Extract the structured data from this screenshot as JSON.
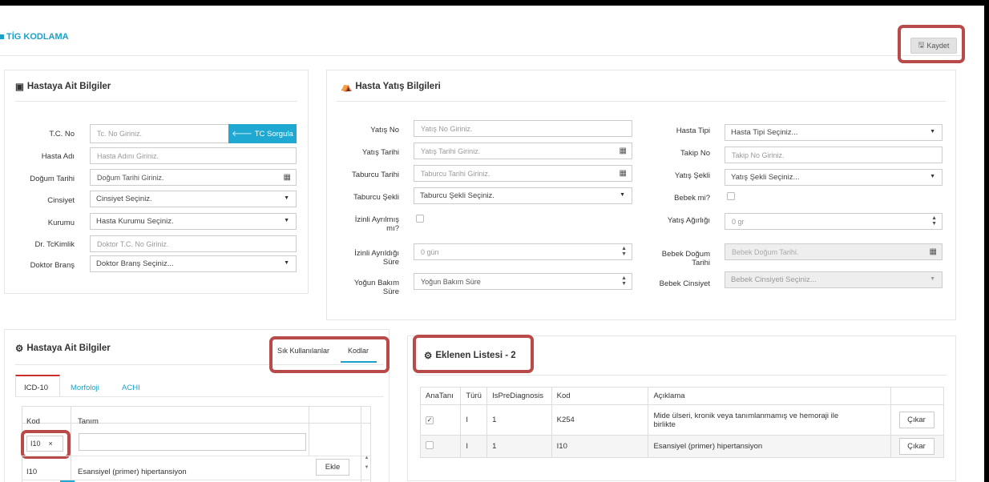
{
  "header": {
    "title": "TİG KODLAMA",
    "save_label": "Kaydet"
  },
  "patient": {
    "title": "Hastaya Ait Bilgiler",
    "tc_label": "T.C. No",
    "tc_placeholder": "Tc. No Giriniz.",
    "tc_button": "TC Sorgula",
    "name_label": "Hasta Adı",
    "name_placeholder": "Hasta Adını Giriniz.",
    "birth_label": "Doğum Tarihi",
    "birth_placeholder": "Doğum Tarihi Giriniz.",
    "gender_label": "Cinsiyet",
    "gender_value": "Cinsiyet Seçiniz.",
    "inst_label": "Kurumu",
    "inst_value": "Hasta Kurumu Seçiniz.",
    "dr_label": "Dr. TcKimlik",
    "dr_placeholder": "Doktor T.C. No Giriniz.",
    "branch_label": "Doktor Branş",
    "branch_value": "Doktor Branş Seçiniz..."
  },
  "admission": {
    "title": "Hasta Yatış Bilgileri",
    "yatis_no_label": "Yatış No",
    "yatis_no_placeholder": "Yatış No Giriniz.",
    "yatis_date_label": "Yatış Tarihi",
    "yatis_date_placeholder": "Yatış Tarihi Giriniz.",
    "discharge_date_label": "Taburcu Tarihi",
    "discharge_date_placeholder": "Taburcu Tarihi Giriniz.",
    "discharge_type_label": "Taburcu Şekli",
    "discharge_type_value": "Taburcu Şekli Seçiniz.",
    "leave_label_1": "İzinli Ayrılmış",
    "leave_label_2": "mı?",
    "leave_dur_label_1": "İzinli Ayrıldığı",
    "leave_dur_label_2": "Süre",
    "leave_dur_value": "0 gün",
    "icu_label_1": "Yoğun Bakım",
    "icu_label_2": "Süre",
    "icu_value": "Yoğun Bakım Süre",
    "patient_type_label": "Hasta Tipi",
    "patient_type_value": "Hasta Tipi Seçiniz...",
    "follow_label": "Takip No",
    "follow_placeholder": "Takip No Giriniz.",
    "adm_type_label": "Yatış Şekli",
    "adm_type_value": "Yatış Şekli Seçiniz...",
    "baby_label": "Bebek mi?",
    "weight_label": "Yatış Ağırlığı",
    "weight_value": "0 gr",
    "baby_birth_label_1": "Bebek Doğum",
    "baby_birth_label_2": "Tarihi",
    "baby_birth_placeholder": "Bebek Doğum Tarihi.",
    "baby_gender_label": "Bebek Cinsiyet",
    "baby_gender_value": "Bebek Cinsiyeti Seçiniz..."
  },
  "codes": {
    "title": "Hastaya Ait Bilgiler",
    "toggle_frequent": "Sık Kullanılanlar",
    "toggle_codes": "Kodlar",
    "tabs": [
      "ICD-10",
      "Morfoloji",
      "ACHI"
    ],
    "col_code": "Kod",
    "col_desc": "Tanım",
    "filter_value": "I10",
    "clear": "×",
    "row_code": "I10",
    "row_desc": "Esansiyel (primer) hipertansiyon",
    "add": "Ekle"
  },
  "added": {
    "title": "Eklenen Listesi - 2",
    "headers": [
      "AnaTanı",
      "Türü",
      "IsPreDiagnosis",
      "Kod",
      "Açıklama"
    ],
    "rows": [
      {
        "type": "I",
        "pre": "1",
        "code": "K254",
        "desc1": "Mide ülseri, kronik veya tanımlanmamış ve hemoraji ile",
        "desc2": "birlikte",
        "action": "Çıkar",
        "main": true
      },
      {
        "type": "I",
        "pre": "1",
        "code": "I10",
        "desc1": "Esansiyel (primer) hipertansiyon",
        "desc2": "",
        "action": "Çıkar",
        "main": false
      }
    ]
  }
}
